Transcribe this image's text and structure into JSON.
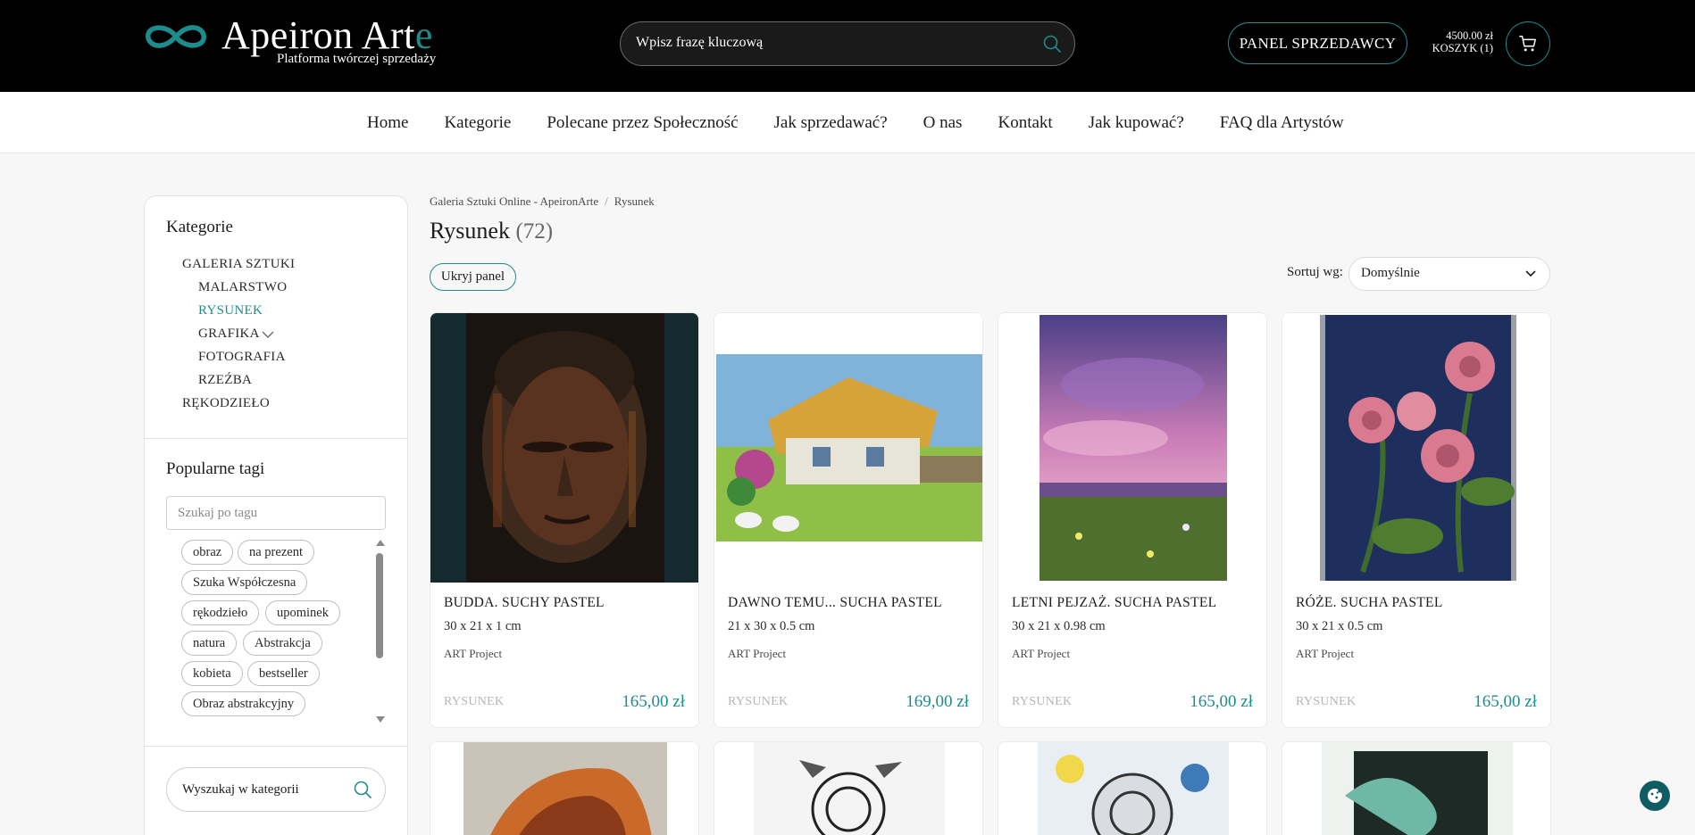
{
  "header": {
    "logo_title": "Apeiron Art",
    "logo_title_accent": "e",
    "logo_subtitle": "Platforma twórczej sprzedaży",
    "search_placeholder": "Wpisz frazę kluczową",
    "seller_panel_label": "PANEL SPRZEDAWCY",
    "cart_total": "4500.00 zł",
    "cart_label": "KOSZYK (1)"
  },
  "nav": {
    "items": [
      "Home",
      "Kategorie",
      "Polecane przez Społeczność",
      "Jak sprzedawać?",
      "O nas",
      "Kontakt",
      "Jak kupować?",
      "FAQ dla Artystów"
    ]
  },
  "sidebar": {
    "categories_heading": "Kategorie",
    "categories": [
      {
        "label": "GALERIA SZTUKI"
      },
      {
        "label": "MALARSTWO"
      },
      {
        "label": "RYSUNEK",
        "active": true
      },
      {
        "label": "GRAFIKA"
      },
      {
        "label": "FOTOGRAFIA"
      },
      {
        "label": "RZEŹBA"
      },
      {
        "label": "RĘKODZIEŁO"
      }
    ],
    "tags_heading": "Popularne tagi",
    "tag_search_placeholder": "Szukaj po tagu",
    "tags": [
      "obraz",
      "na prezent",
      "Szuka Współczesna",
      "rękodzieło",
      "upominek",
      "natura",
      "Abstrakcja",
      "kobieta",
      "bestseller",
      "Obraz abstrakcyjny"
    ],
    "category_search_placeholder": "Wyszukaj w kategorii"
  },
  "main": {
    "breadcrumb": [
      "Galeria Sztuki Online - ApeironArte",
      "Rysunek"
    ],
    "breadcrumb_separator": "/",
    "title": "Rysunek",
    "count": "(72)",
    "hide_panel_label": "Ukryj panel",
    "sort_label": "Sortuj wg:",
    "sort_value": "Domyślnie",
    "products": [
      {
        "title": "BUDDA. SUCHY PASTEL",
        "dimensions": "30 x 21 x 1 cm",
        "artist": "ART Project",
        "category": "RYSUNEK",
        "price": "165,00 zł"
      },
      {
        "title": "DAWNO TEMU... SUCHA PASTEL",
        "dimensions": "21 x 30 x 0.5 cm",
        "artist": "ART Project",
        "category": "RYSUNEK",
        "price": "169,00 zł"
      },
      {
        "title": "LETNI PEJZAŻ. SUCHA PASTEL",
        "dimensions": "30 x 21 x 0.98 cm",
        "artist": "ART Project",
        "category": "RYSUNEK",
        "price": "165,00 zł"
      },
      {
        "title": "RÓŻE. SUCHA PASTEL",
        "dimensions": "30 x 21 x 0.5 cm",
        "artist": "ART Project",
        "category": "RYSUNEK",
        "price": "165,00 zł"
      }
    ]
  },
  "colors": {
    "accent": "#1e8c8c",
    "header_bg": "#000000",
    "page_bg": "#f7f7f7"
  },
  "icons": [
    "logo-infinity-icon",
    "search-icon",
    "cart-icon",
    "chevron-down-icon",
    "cookie-icon"
  ]
}
